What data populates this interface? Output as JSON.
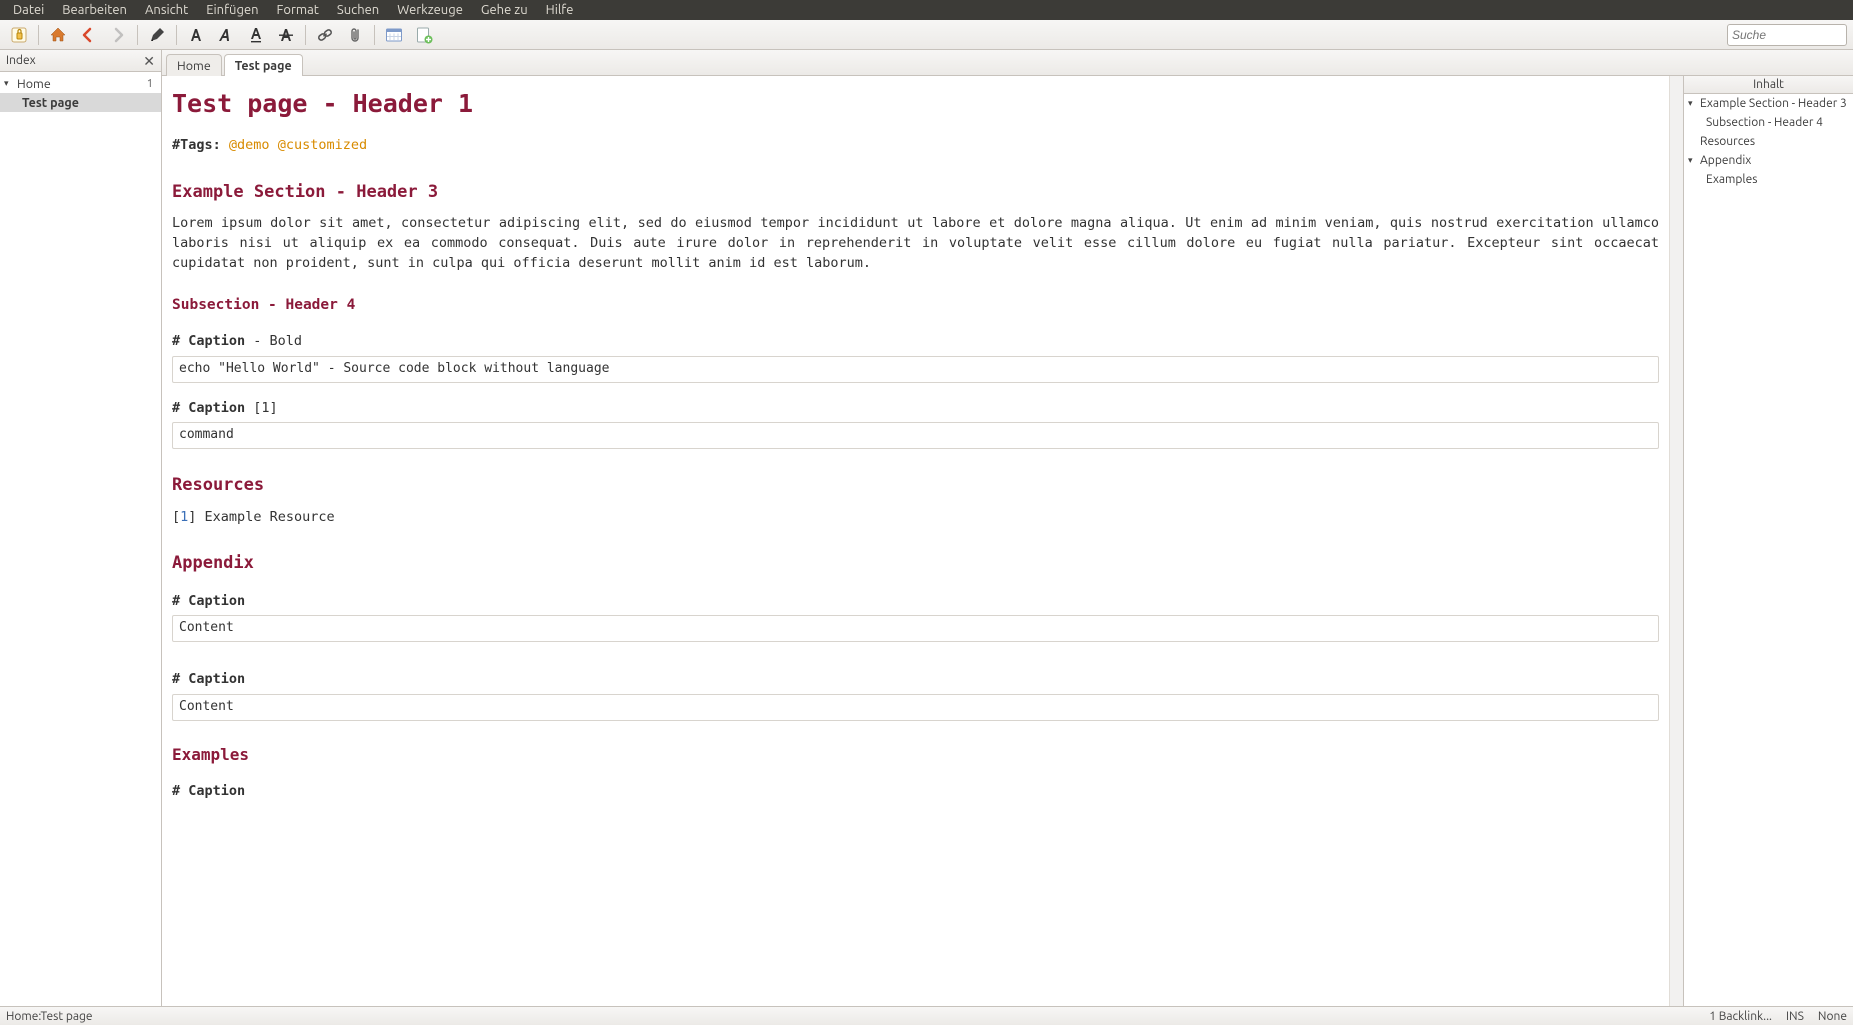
{
  "menu": {
    "items": [
      "Datei",
      "Bearbeiten",
      "Ansicht",
      "Einfügen",
      "Format",
      "Suchen",
      "Werkzeuge",
      "Gehe zu",
      "Hilfe"
    ]
  },
  "toolbar": {
    "search_placeholder": "Suche"
  },
  "index": {
    "title": "Index",
    "home": {
      "label": "Home",
      "count": "1"
    },
    "child": {
      "label": "Test page"
    }
  },
  "pathbar": {
    "tab_home": "Home",
    "tab_current": "Test page"
  },
  "page": {
    "title": "Test page - Header 1",
    "tags_label": "#Tags: ",
    "tag1": "@demo",
    "tag2": "@customized",
    "h3_example": "Example Section - Header 3",
    "lorem": "Lorem ipsum dolor sit amet, consectetur adipiscing elit, sed do eiusmod tempor incididunt ut labore et dolore magna aliqua. Ut enim ad minim veniam, quis nostrud exercitation ullamco laboris nisi ut aliquip ex ea commodo consequat. Duis aute irure dolor in reprehenderit in voluptate velit esse cillum dolore eu fugiat nulla pariatur. Excepteur sint occaecat cupidatat non proident, sunt in culpa qui officia deserunt mollit anim id est laborum.",
    "h4_sub": "Subsection - Header 4",
    "cap1": "# Caption",
    "cap1_suffix": " - Bold",
    "code1": "echo \"Hello World\" - Source code block without language",
    "cap2": "# Caption ",
    "cap2_suffix": "[1]",
    "code2": "command",
    "h3_res": "Resources",
    "res_bracket_open": "[",
    "res_link": "1",
    "res_bracket_close": "]",
    "res_text": " Example Resource",
    "h3_app": "Appendix",
    "cap3": "# Caption",
    "code3": "Content",
    "cap4": "# Caption",
    "code4": "Content",
    "h4_ex": "Examples",
    "cap5": "# Caption"
  },
  "toc": {
    "title": "Inhalt",
    "i1": "Example Section - Header 3",
    "i2": "Subsection - Header 4",
    "i3": "Resources",
    "i4": "Appendix",
    "i5": "Examples"
  },
  "status": {
    "path": "Home:Test page",
    "backlinks": "1 Backlink...",
    "mode": "INS",
    "extra": "None"
  }
}
